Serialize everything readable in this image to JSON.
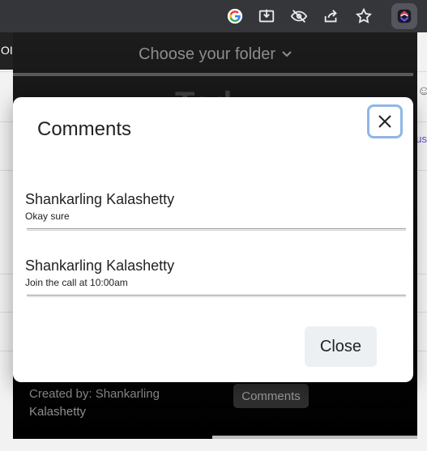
{
  "browser_toolbar": {
    "icons": [
      "google-icon",
      "install-app-icon",
      "eye-off-icon",
      "share-icon",
      "star-icon",
      "extension-icon"
    ]
  },
  "page_behind": {
    "left_edge_text": "OI",
    "right_edge_text": "us"
  },
  "popup": {
    "folder_select_label": "Choose your folder",
    "heading_partial": "Tod",
    "created_by": "Created by: Shankarling Kalashetty",
    "comments_button_label": "Comments"
  },
  "modal": {
    "title": "Comments",
    "comments": [
      {
        "author": "Shankarling Kalashetty",
        "text": "Okay sure"
      },
      {
        "author": "Shankarling Kalashetty",
        "text": "Join the call at 10:00am"
      }
    ],
    "close_button_label": "Close"
  },
  "colors": {
    "toolbar_bg": "#35363a",
    "popup_bg": "#0b0b0b",
    "modal_bg": "#ffffff",
    "close_focus_ring": "#8fb7e6",
    "close_button_bg": "#edf0f3"
  }
}
